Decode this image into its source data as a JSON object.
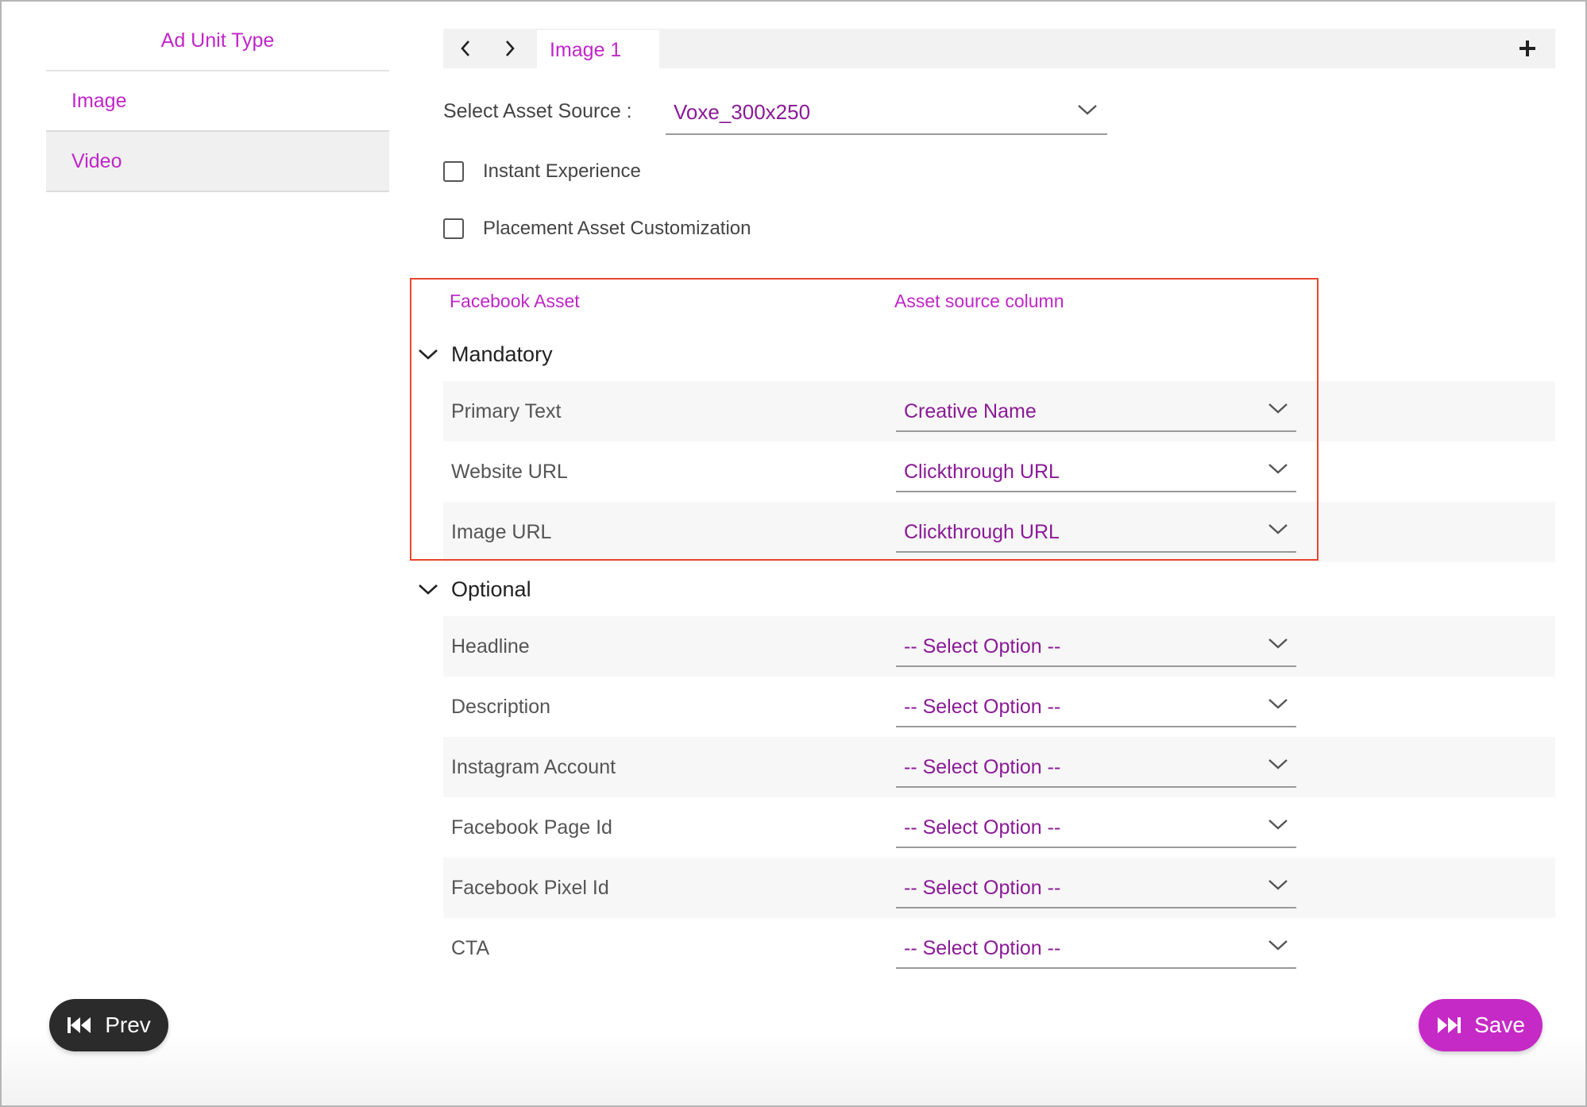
{
  "sidebar": {
    "title": "Ad Unit Type",
    "items": [
      {
        "label": "Image",
        "active": false
      },
      {
        "label": "Video",
        "active": true
      }
    ]
  },
  "tabs": {
    "prev_icon": "chevron-left-icon",
    "next_icon": "chevron-right-icon",
    "active_tab": "Image 1",
    "add_icon": "plus-icon"
  },
  "asset_source": {
    "label": "Select Asset Source :",
    "value": "Voxe_300x250"
  },
  "checkboxes": {
    "instant_experience": "Instant Experience",
    "placement_customization": "Placement Asset Customization"
  },
  "columns": {
    "facebook_asset": "Facebook Asset",
    "asset_source_column": "Asset source column"
  },
  "mandatory": {
    "title": "Mandatory",
    "rows": [
      {
        "label": "Primary Text",
        "value": "Creative Name"
      },
      {
        "label": "Website URL",
        "value": "Clickthrough URL"
      },
      {
        "label": "Image URL",
        "value": "Clickthrough URL"
      }
    ]
  },
  "optional": {
    "title": "Optional",
    "rows": [
      {
        "label": "Headline",
        "value": "-- Select Option --"
      },
      {
        "label": "Description",
        "value": "-- Select Option --"
      },
      {
        "label": "Instagram Account",
        "value": "-- Select Option --"
      },
      {
        "label": "Facebook Page Id",
        "value": "-- Select Option --"
      },
      {
        "label": "Facebook Pixel Id",
        "value": "-- Select Option --"
      },
      {
        "label": "CTA",
        "value": "-- Select Option --"
      }
    ]
  },
  "buttons": {
    "prev": "Prev",
    "save": "Save"
  },
  "colors": {
    "accent": "#c026c8",
    "value_text": "#8a1a96",
    "highlight": "#e8452c",
    "prev_button": "#2b2b2b",
    "save_button": "#c62ac6"
  }
}
